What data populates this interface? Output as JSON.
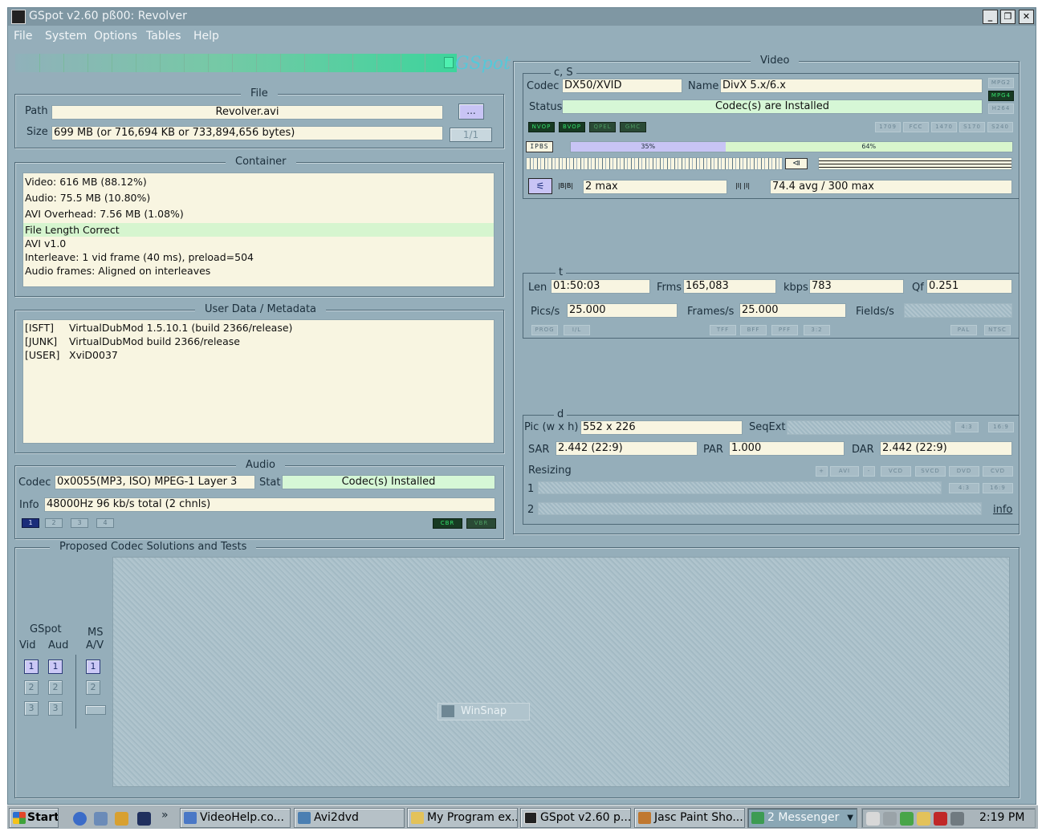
{
  "window": {
    "title": "GSpot v2.60 pß00: Revolver"
  },
  "menu": [
    "File",
    "System",
    "Options",
    "Tables",
    "Help"
  ],
  "logo": "GSpot",
  "file": {
    "title": "File",
    "path_label": "Path",
    "path": "Revolver.avi",
    "browse": "...",
    "size_label": "Size",
    "size": "699 MB (or 716,694 KB or 733,894,656 bytes)",
    "part": "1/1"
  },
  "container": {
    "title": "Container",
    "lines": [
      "Video: 616 MB (88.12%)",
      "Audio: 75.5 MB (10.80%)",
      "AVI Overhead: 7.56 MB (1.08%)",
      "File Length Correct",
      "AVI v1.0",
      "Interleave: 1 vid frame (40 ms), preload=504",
      "Audio frames: Aligned on interleaves"
    ]
  },
  "userdata": {
    "title": "User Data / Metadata",
    "rows": [
      {
        "tag": "[ISFT]",
        "value": "VirtualDubMod 1.5.10.1 (build 2366/release)"
      },
      {
        "tag": "[JUNK]",
        "value": "VirtualDubMod build 2366/release"
      },
      {
        "tag": "[USER]",
        "value": "XviD0037"
      }
    ]
  },
  "audio": {
    "title": "Audio",
    "codec_label": "Codec",
    "codec": "0x0055(MP3, ISO) MPEG-1 Layer 3",
    "stat_label": "Stat",
    "stat": "Codec(s) Installed",
    "info_label": "Info",
    "info": "48000Hz  96 kb/s total (2 chnls)",
    "streams": [
      "1",
      "2",
      "3",
      "4"
    ],
    "mode_tags": [
      "CBR",
      "VBR"
    ]
  },
  "video": {
    "title": "Video",
    "cs_title": "c, S",
    "codec_label": "Codec",
    "codec": "DX50/XVID",
    "name_label": "Name",
    "name": "DivX 5.x/6.x",
    "status_label": "Status",
    "status": "Codec(s) are Installed",
    "format_tags": [
      "MPG2",
      "MPG4",
      "H264"
    ],
    "vop_tags": [
      "NVOP",
      "BVOP",
      "QPEL",
      "GMC"
    ],
    "std_tags": [
      "1709",
      "FCC",
      "1470",
      "S170",
      "S240"
    ],
    "frame_types": "IPBS",
    "pct_a": "35%",
    "pct_b": "64%",
    "bframes": "2 max",
    "rate": "74.4 avg / 300 max",
    "t_title": "t",
    "len_label": "Len",
    "len": "01:50:03",
    "frms_label": "Frms",
    "frms": "165,083",
    "kbps_label": "kbps",
    "kbps": "783",
    "qf_label": "Qf",
    "qf": "0.251",
    "pics_label": "Pics/s",
    "pics": "25.000",
    "frames_label": "Frames/s",
    "frames": "25.000",
    "fields_label": "Fields/s",
    "scan_tags": [
      "PROG",
      "I/L",
      "TFF",
      "BFF",
      "PFF",
      "3:2",
      "PAL",
      "NTSC"
    ],
    "d_title": "d",
    "pic_label": "Pic (w x h)",
    "pic": "552 x 226",
    "seqext_label": "SeqExt",
    "aspect_tags": [
      "4:3",
      "16:9"
    ],
    "sar_label": "SAR",
    "sar": "2.442 (22:9)",
    "par_label": "PAR",
    "par": "1.000",
    "dar_label": "DAR",
    "dar": "2.442 (22:9)",
    "resizing_label": "Resizing",
    "resize_tags": [
      "+",
      "AVI",
      "-",
      "VCD",
      "SVCD",
      "DVD",
      "CVD"
    ],
    "row1": "1",
    "row2": "2",
    "aspect2_tags": [
      "4:3",
      "16:9"
    ],
    "info_link": "info"
  },
  "proposed": {
    "title": "Proposed Codec Solutions and Tests",
    "gspot_label": "GSpot",
    "vid_label": "Vid",
    "aud_label": "Aud",
    "ms_label": "MS",
    "av_label": "A/V",
    "buttons": [
      "1",
      "2",
      "3"
    ],
    "winsnap": "WinSnap"
  },
  "taskbar": {
    "start": "Start",
    "chevron": "»",
    "items": [
      "VideoHelp.co...",
      "Avi2dvd",
      "My Program ex...",
      "GSpot v2.60 p...",
      "Jasc Paint Sho...",
      "2 Messenger"
    ],
    "clock": "2:19 PM"
  }
}
